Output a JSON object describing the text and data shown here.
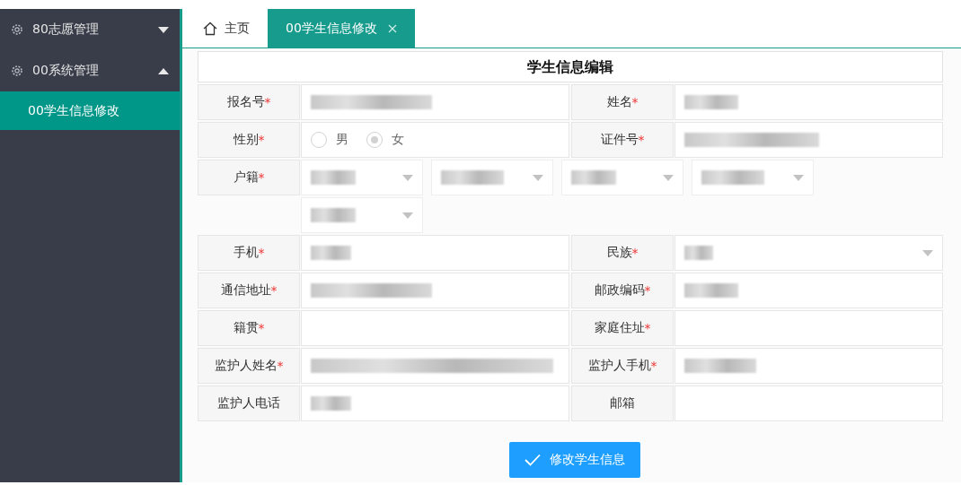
{
  "sidebar": {
    "menus": [
      {
        "label": "80志愿管理",
        "expanded": false
      },
      {
        "label": "00系统管理",
        "expanded": true,
        "children": [
          {
            "label": "00学生信息修改",
            "selected": true
          }
        ]
      }
    ]
  },
  "tabs": [
    {
      "label": "主页",
      "kind": "home",
      "selected": false
    },
    {
      "label": "00学生信息修改",
      "kind": "closable",
      "selected": true
    }
  ],
  "form": {
    "title": "学生信息编辑",
    "rows": [
      {
        "kind": "pair",
        "fields": [
          {
            "label": "报名号",
            "mark": "*",
            "kind": "text",
            "filled": true
          },
          {
            "label": "姓名",
            "mark": "*",
            "kind": "text",
            "filled": true
          }
        ]
      },
      {
        "kind": "pair",
        "fields": [
          {
            "label": "性别",
            "mark": "*",
            "kind": "radio",
            "options": [
              {
                "label": "男",
                "selected": false
              },
              {
                "label": "女",
                "selected": true
              }
            ]
          },
          {
            "label": "证件号",
            "mark": "*",
            "kind": "text",
            "filled": true
          }
        ]
      },
      {
        "kind": "region",
        "fields": [
          {
            "label": "户籍",
            "mark": "*",
            "kind": "region",
            "dropdowns": [
              {
                "filled": true
              },
              {
                "filled": true
              },
              {
                "filled": true
              },
              {
                "filled": true
              },
              {
                "filled": true
              }
            ]
          }
        ]
      },
      {
        "kind": "pair",
        "fields": [
          {
            "label": "手机",
            "mark": "*",
            "kind": "text",
            "filled": true
          },
          {
            "label": "民族",
            "mark": "*",
            "kind": "select",
            "filled": true
          }
        ]
      },
      {
        "kind": "pair",
        "fields": [
          {
            "label": "通信地址",
            "mark": "*",
            "kind": "text",
            "filled": true
          },
          {
            "label": "邮政编码",
            "mark": "*",
            "kind": "text",
            "filled": true
          }
        ]
      },
      {
        "kind": "pair",
        "fields": [
          {
            "label": "籍贯",
            "mark": "*",
            "kind": "text",
            "filled": false
          },
          {
            "label": "家庭住址",
            "mark": "*",
            "kind": "text",
            "filled": false
          }
        ]
      },
      {
        "kind": "pair",
        "fields": [
          {
            "label": "监护人姓名",
            "mark": "*",
            "kind": "text",
            "filled": true
          },
          {
            "label": "监护人手机",
            "mark": "*",
            "kind": "text",
            "filled": true
          }
        ]
      },
      {
        "kind": "pair",
        "fields": [
          {
            "label": "监护人电话",
            "kind": "text",
            "filled": true
          },
          {
            "label": "邮箱",
            "kind": "text",
            "filled": false
          }
        ]
      }
    ],
    "submit": {
      "label": "修改学生信息"
    }
  }
}
